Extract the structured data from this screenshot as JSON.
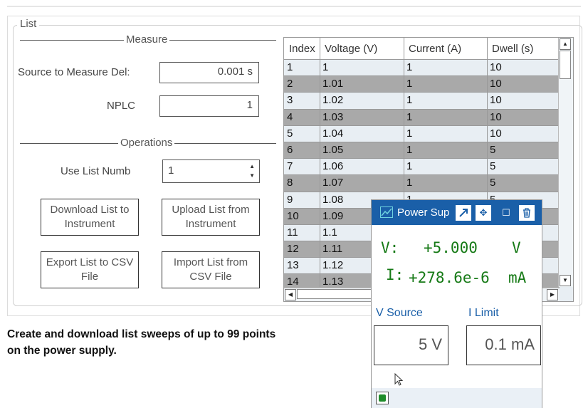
{
  "group_title": "List",
  "measure": {
    "title": "Measure",
    "delay_label": "Source to Measure Del:",
    "delay_value": "0.001 s",
    "nplc_label": "NPLC",
    "nplc_value": "1"
  },
  "operations": {
    "title": "Operations",
    "list_label": "Use List Numb",
    "list_value": "1",
    "download_label": "Download List to Instrument",
    "upload_label": "Upload List from Instrument",
    "export_label": "Export List to CSV File",
    "import_label": "Import List from CSV File"
  },
  "table": {
    "headers": [
      "Index",
      "Voltage (V)",
      "Current (A)",
      "Dwell (s)"
    ],
    "rows": [
      {
        "index": "1",
        "voltage": "1",
        "current": "1",
        "dwell": "10"
      },
      {
        "index": "2",
        "voltage": "1.01",
        "current": "1",
        "dwell": "10"
      },
      {
        "index": "3",
        "voltage": "1.02",
        "current": "1",
        "dwell": "10"
      },
      {
        "index": "4",
        "voltage": "1.03",
        "current": "1",
        "dwell": "10"
      },
      {
        "index": "5",
        "voltage": "1.04",
        "current": "1",
        "dwell": "10"
      },
      {
        "index": "6",
        "voltage": "1.05",
        "current": "1",
        "dwell": "5"
      },
      {
        "index": "7",
        "voltage": "1.06",
        "current": "1",
        "dwell": "5"
      },
      {
        "index": "8",
        "voltage": "1.07",
        "current": "1",
        "dwell": "5"
      },
      {
        "index": "9",
        "voltage": "1.08",
        "current": "1",
        "dwell": "5"
      },
      {
        "index": "10",
        "voltage": "1.09",
        "current": "",
        "dwell": ""
      },
      {
        "index": "11",
        "voltage": "1.1",
        "current": "",
        "dwell": ""
      },
      {
        "index": "12",
        "voltage": "1.11",
        "current": "",
        "dwell": ""
      },
      {
        "index": "13",
        "voltage": "1.12",
        "current": "",
        "dwell": ""
      },
      {
        "index": "14",
        "voltage": "1.13",
        "current": "",
        "dwell": ""
      }
    ]
  },
  "caption": "Create and download list sweeps of up to 99 points on the power supply.",
  "power_supply": {
    "title": "Power Sup",
    "v_label": "V:",
    "v_value": "+5.000",
    "v_unit": "V",
    "i_label": "I:",
    "i_value": "+278.6e-6",
    "i_unit": "mA",
    "v_source_label": "V Source",
    "i_limit_label": "I Limit",
    "v_source_value": "5 V",
    "i_limit_value": "0.1 mA",
    "colors": {
      "title_bar": "#1a5fa8",
      "readout": "#167a16",
      "status_led": "#1e8c2a"
    }
  },
  "icons": [
    "scroll-up-icon",
    "scroll-down-icon",
    "scroll-left-icon",
    "scroll-right-icon",
    "app-icon",
    "popout-icon",
    "move-icon",
    "maximize-icon",
    "trash-icon",
    "mouse-cursor-icon"
  ]
}
